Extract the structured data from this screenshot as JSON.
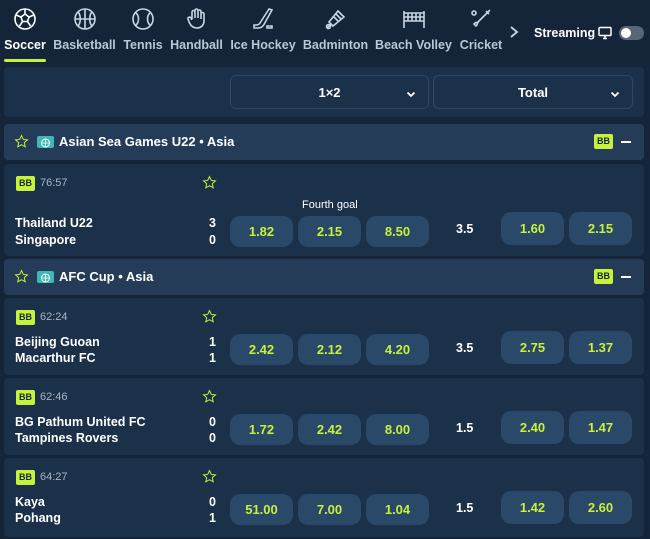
{
  "sports": [
    {
      "label": "Soccer",
      "icon": "soccer-ball-icon",
      "active": true
    },
    {
      "label": "Basketball",
      "icon": "basketball-icon",
      "active": false
    },
    {
      "label": "Tennis",
      "icon": "tennis-ball-icon",
      "active": false
    },
    {
      "label": "Handball",
      "icon": "handball-icon",
      "active": false
    },
    {
      "label": "Ice Hockey",
      "icon": "hockey-stick-icon",
      "active": false
    },
    {
      "label": "Badminton",
      "icon": "shuttlecock-icon",
      "active": false
    },
    {
      "label": "Beach Volley",
      "icon": "volleyball-net-icon",
      "active": false
    },
    {
      "label": "Cricket",
      "icon": "cricket-bat-icon",
      "active": false
    }
  ],
  "streaming": {
    "label": "Streaming",
    "enabled": false
  },
  "markets": {
    "primary": "1×2",
    "secondary": "Total"
  },
  "colors": {
    "accent": "#c7f23c",
    "background": "#14253a",
    "card": "#1b3049",
    "league": "#243c58",
    "odd": "#2a4868"
  },
  "leagues": [
    {
      "name": "Asian Sea Games U22 • Asia",
      "badge": "BB",
      "matches": [
        {
          "badge": "BB",
          "time": "76:57",
          "home": "Thailand U22",
          "away": "Singapore",
          "home_score": "3",
          "away_score": "0",
          "extra": "Fourth goal",
          "odds": [
            "1.82",
            "2.15",
            "8.50"
          ],
          "total": "3.5",
          "total_odds": [
            "1.60",
            "2.15"
          ]
        }
      ]
    },
    {
      "name": "AFC Cup • Asia",
      "badge": "BB",
      "matches": [
        {
          "badge": "BB",
          "time": "62:24",
          "home": "Beijing Guoan",
          "away": "Macarthur FC",
          "home_score": "1",
          "away_score": "1",
          "odds": [
            "2.42",
            "2.12",
            "4.20"
          ],
          "total": "3.5",
          "total_odds": [
            "2.75",
            "1.37"
          ]
        },
        {
          "badge": "BB",
          "time": "62:46",
          "home": "BG Pathum United FC",
          "away": "Tampines Rovers",
          "home_score": "0",
          "away_score": "0",
          "odds": [
            "1.72",
            "2.42",
            "8.00"
          ],
          "total": "1.5",
          "total_odds": [
            "2.40",
            "1.47"
          ]
        },
        {
          "badge": "BB",
          "time": "64:27",
          "home": "Kaya",
          "away": "Pohang",
          "home_score": "0",
          "away_score": "1",
          "odds": [
            "51.00",
            "7.00",
            "1.04"
          ],
          "total": "1.5",
          "total_odds": [
            "1.42",
            "2.60"
          ]
        }
      ]
    }
  ]
}
